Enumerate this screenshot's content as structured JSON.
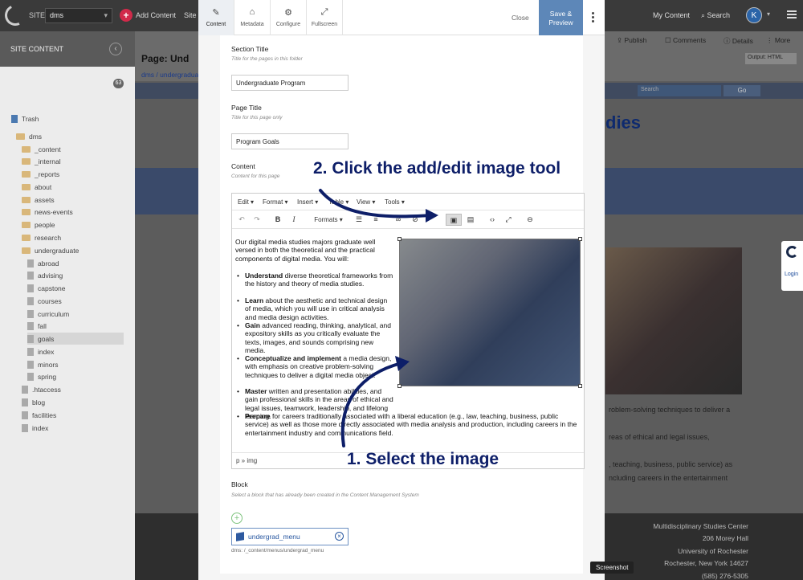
{
  "topbar": {
    "site_label": "SITE:",
    "site_value": "dms",
    "add_content": "Add Content",
    "site_link": "Site",
    "my_content": "My Content",
    "search": "Search",
    "avatar_initial": "K"
  },
  "sidebar": {
    "title": "SITE CONTENT",
    "trash_count": "63",
    "items": [
      {
        "label": "Trash"
      },
      {
        "label": "dms"
      },
      {
        "label": "_content"
      },
      {
        "label": "_internal"
      },
      {
        "label": "_reports"
      },
      {
        "label": "about"
      },
      {
        "label": "assets"
      },
      {
        "label": "news-events"
      },
      {
        "label": "people"
      },
      {
        "label": "research"
      },
      {
        "label": "undergraduate"
      },
      {
        "label": "abroad"
      },
      {
        "label": "advising"
      },
      {
        "label": "capstone"
      },
      {
        "label": "courses"
      },
      {
        "label": "curriculum"
      },
      {
        "label": "fall"
      },
      {
        "label": "goals"
      },
      {
        "label": "index"
      },
      {
        "label": "minors"
      },
      {
        "label": "spring"
      },
      {
        "label": ".htaccess"
      },
      {
        "label": "blog"
      },
      {
        "label": "facilities"
      },
      {
        "label": "index"
      }
    ]
  },
  "background": {
    "page_title": "Page: Und",
    "breadcrumb": "dms / undergradua",
    "publish": "Publish",
    "comments": "Comments",
    "details": "Details",
    "more": "More",
    "output": "Output: HTML",
    "search_placeholder": "Search",
    "go": "Go",
    "heading_fragment": "dies",
    "text_lines": [
      "roblem-solving techniques to deliver a",
      "reas of ethical and legal issues,",
      ", teaching, business, public service) as",
      "ncluding careers in the entertainment"
    ],
    "footer": [
      "Multidisciplinary Studies Center",
      "206 Morey Hall",
      "University of Rochester",
      "Rochester, New York 14627",
      "(585) 276-5305"
    ],
    "login": "Login"
  },
  "modal": {
    "tabs": [
      {
        "label": "Content",
        "icon": "edit-icon"
      },
      {
        "label": "Metadata",
        "icon": "tag-icon"
      },
      {
        "label": "Configure",
        "icon": "gear-icon"
      },
      {
        "label": "Fullscreen",
        "icon": "fullscreen-icon"
      }
    ],
    "close": "Close",
    "save_line1": "Save &",
    "save_line2": "Preview",
    "fields": {
      "section_title_label": "Section Title",
      "section_title_hint": "Title for the pages in this folder",
      "section_title_value": "Undergraduate Program",
      "page_title_label": "Page Title",
      "page_title_hint": "Title for this page only",
      "page_title_value": "Program Goals",
      "content_label": "Content",
      "content_hint": "Content for this page",
      "block_label": "Block",
      "block_hint": "Select a block that has already been created in the Content Management System",
      "block_value": "undergrad_menu",
      "block_path": "dms: /_content/menus/undergrad_menu"
    },
    "editor": {
      "menus": [
        "Edit ▾",
        "Format ▾",
        "Insert ▾",
        "Table ▾",
        "View ▾",
        "Tools ▾"
      ],
      "formats": "Formats ▾",
      "status_path": "p » img",
      "intro": "Our digital media studies majors graduate well versed in both the theoretical and the practical components of digital media. You will:",
      "bullets": [
        {
          "bold": "Understand",
          "text": " diverse theoretical frameworks from the history and theory of media studies."
        },
        {
          "bold": "Learn",
          "text": " about the aesthetic and technical design of media, which you will use in critical analysis and media design activities."
        },
        {
          "bold": "Gain",
          "text": " advanced reading, thinking, analytical, and expository skills as you critically evaluate the texts, images, and sounds comprising new media."
        },
        {
          "bold": "Conceptualize and implement",
          "text": " a media design, with emphasis on creative problem-solving techniques to deliver a digital media object."
        },
        {
          "bold": "Master",
          "text": " written and presentation abilities, and gain professional skills in the areas of ethical and legal issues, teamwork, leadership, and lifelong learning."
        },
        {
          "bold": "Prepare",
          "text": " for careers traditionally associated with a liberal education (e.g., law, teaching, business, public service) as well as those more directly associated with media analysis and production, including careers in the entertainment industry and communications field."
        }
      ]
    }
  },
  "annotations": {
    "step1": "1. Select the image",
    "step2": "2. Click the add/edit image tool"
  },
  "tooltip": "Screenshot"
}
